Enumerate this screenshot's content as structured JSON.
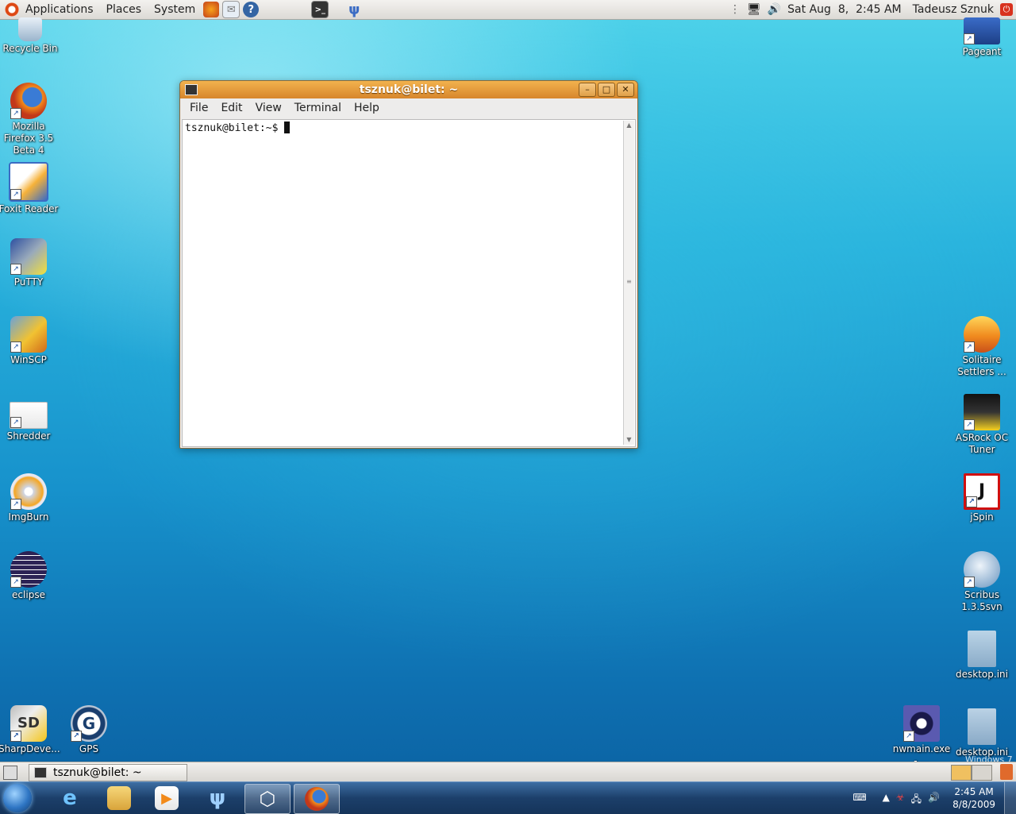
{
  "top_panel": {
    "menus": [
      "Applications",
      "Places",
      "System"
    ],
    "clock": "Sat Aug  8,  2:45 AM",
    "user": "Tadeusz Sznuk"
  },
  "desktop_icons_left": [
    {
      "label": "Recycle Bin"
    },
    {
      "label": "Mozilla Firefox 3.5 Beta 4"
    },
    {
      "label": "Foxit Reader"
    },
    {
      "label": "PuTTY"
    },
    {
      "label": "WinSCP"
    },
    {
      "label": "Shredder"
    },
    {
      "label": "ImgBurn"
    },
    {
      "label": "eclipse"
    },
    {
      "label": "SharpDeve..."
    },
    {
      "label": "GPS"
    }
  ],
  "desktop_icons_right": [
    {
      "label": "Pageant"
    },
    {
      "label": "Solitaire Settlers ..."
    },
    {
      "label": "ASRock OC Tuner"
    },
    {
      "label": "jSpin"
    },
    {
      "label": "Scribus 1.3.5svn"
    },
    {
      "label": "desktop.ini"
    },
    {
      "label": "nwmain.exe - ..."
    },
    {
      "label": "desktop.ini"
    }
  ],
  "terminal": {
    "title": "tsznuk@bilet: ~",
    "menu": [
      "File",
      "Edit",
      "View",
      "Terminal",
      "Help"
    ],
    "prompt": "tsznuk@bilet:~$ "
  },
  "bottom_panel": {
    "task_label": "tsznuk@bilet: ~"
  },
  "win7_taskbar": {
    "time": "2:45 AM",
    "date": "8/8/2009"
  },
  "watermark": "Windows 7"
}
